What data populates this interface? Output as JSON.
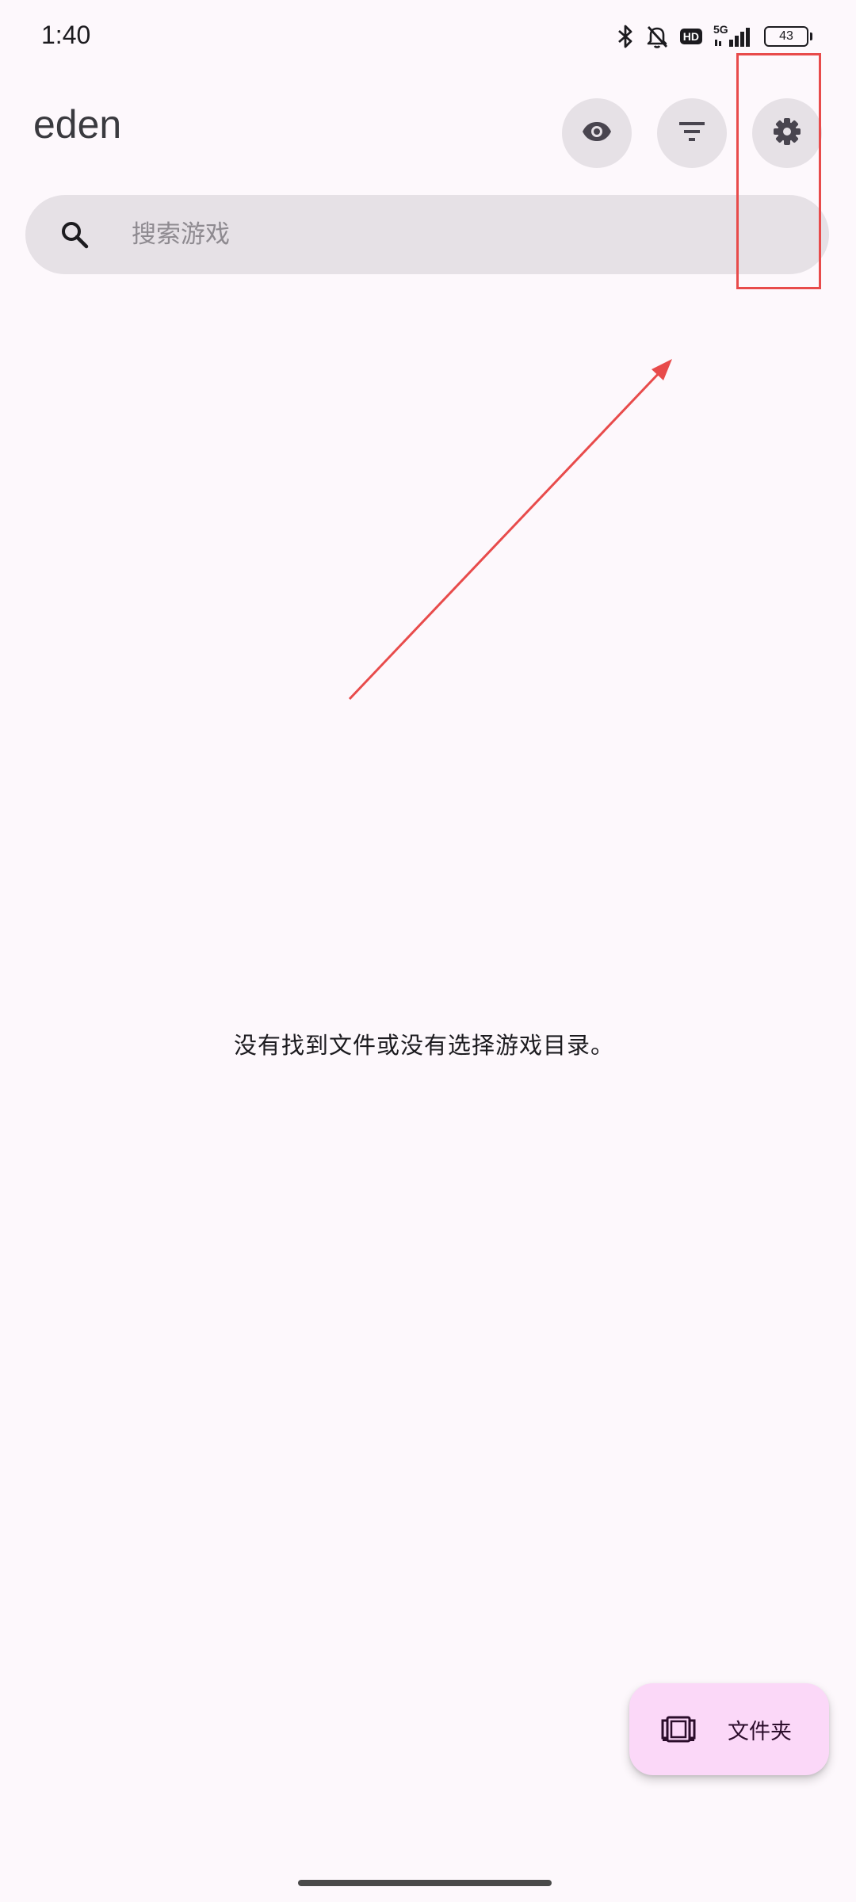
{
  "status_bar": {
    "time": "1:40",
    "network": "5G",
    "hd_badge": "HD",
    "battery_level": "43",
    "icons": [
      "bluetooth-icon",
      "bell-off-icon",
      "hd-icon",
      "signal-icon",
      "battery-icon"
    ]
  },
  "app_bar": {
    "title": "eden",
    "actions": [
      {
        "name": "eye-button",
        "icon": "eye-icon"
      },
      {
        "name": "filter-button",
        "icon": "filter-icon"
      },
      {
        "name": "settings-button",
        "icon": "gear-icon"
      }
    ]
  },
  "search": {
    "placeholder": "搜索游戏",
    "value": "",
    "icon": "search-icon"
  },
  "main": {
    "empty_message": "没有找到文件或没有选择游戏目录。"
  },
  "fab": {
    "label": "文件夹",
    "icon": "game-cartridge-icon"
  },
  "annotation": {
    "color": "#e84b4b",
    "target": "settings-button"
  },
  "colors": {
    "background": "#fdf8fc",
    "surface_variant": "#e6e1e6",
    "fab_container": "#fbd8f8"
  }
}
